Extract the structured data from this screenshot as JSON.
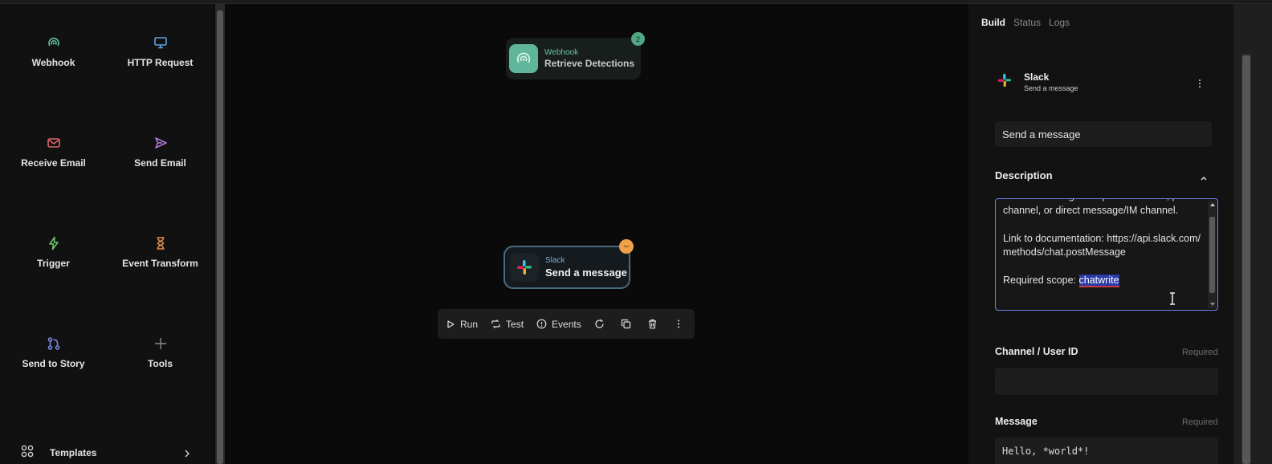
{
  "palette": {
    "tools": [
      {
        "label": "Webhook",
        "icon": "webhook-icon",
        "color": "#5fc29e"
      },
      {
        "label": "HTTP Request",
        "icon": "monitor-icon",
        "color": "#5aa6e6"
      },
      {
        "label": "Receive Email",
        "icon": "mail-icon",
        "color": "#e0646b"
      },
      {
        "label": "Send Email",
        "icon": "send-icon",
        "color": "#b07ad8"
      },
      {
        "label": "Trigger",
        "icon": "lightning-icon",
        "color": "#6bc26b"
      },
      {
        "label": "Event Transform",
        "icon": "hourglass-icon",
        "color": "#e08a4a"
      },
      {
        "label": "Send to Story",
        "icon": "story-icon",
        "color": "#7a86e0"
      },
      {
        "label": "Tools",
        "icon": "plus-icon",
        "color": "#8a8a8a"
      }
    ],
    "templates_label": "Templates"
  },
  "canvas": {
    "webhook_node": {
      "type": "Webhook",
      "title": "Retrieve Detections",
      "badge": "2"
    },
    "slack_node": {
      "type": "Slack",
      "title": "Send a message"
    },
    "actions": {
      "run": "Run",
      "test": "Test",
      "events": "Events"
    }
  },
  "panel": {
    "tabs": [
      "Build",
      "Status",
      "Logs"
    ],
    "active_tab": "Build",
    "integration": {
      "name": "Slack",
      "subtitle": "Send a message"
    },
    "action_name_value": "Send a message",
    "description_title": "Description",
    "description": {
      "text": "Posts a message to a public channel, private channel, or direct message/IM channel.\n\nLink to documentation: https://api.slack.com/methods/chat.postMessage\n\nRequired scope: ",
      "highlighted": "chatwrite"
    },
    "channel_label": "Channel / User ID",
    "channel_value": "",
    "message_label": "Message",
    "message_value": "Hello, *world*!",
    "required_label": "Required"
  }
}
